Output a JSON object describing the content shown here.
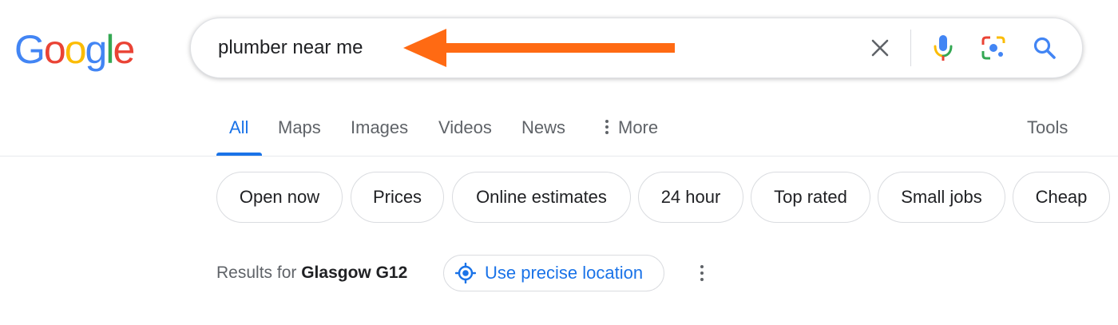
{
  "logo": {
    "letters": [
      "G",
      "o",
      "o",
      "g",
      "l",
      "e"
    ],
    "colors": [
      "#4285f4",
      "#ea4335",
      "#fbbc05",
      "#4285f4",
      "#34a853",
      "#ea4335"
    ]
  },
  "search": {
    "query": "plumber near me",
    "annotation_arrow_color": "#ff6a13",
    "icons": [
      "close-icon",
      "mic-icon",
      "camera-lens-icon",
      "search-icon"
    ]
  },
  "tabs": {
    "items": [
      "All",
      "Maps",
      "Images",
      "Videos",
      "News",
      "More"
    ],
    "active": "All",
    "tools": "Tools",
    "accent": "#1a73e8"
  },
  "chips": [
    "Open now",
    "Prices",
    "Online estimates",
    "24 hour",
    "Top rated",
    "Small jobs",
    "Cheap"
  ],
  "location": {
    "results_prefix": "Results for",
    "place": "Glasgow G12",
    "precise_button": "Use precise location"
  }
}
